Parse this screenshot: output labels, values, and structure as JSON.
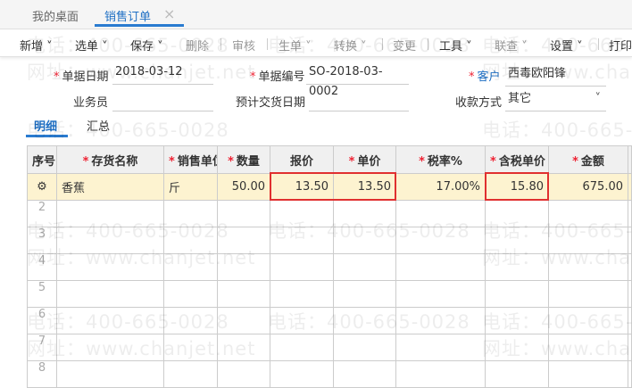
{
  "tabs": [
    {
      "label": "我的桌面"
    },
    {
      "label": "销售订单",
      "close": "×"
    }
  ],
  "toolbar": [
    "新增",
    "选单",
    "保存",
    "删除",
    "审核",
    "生单",
    "转换",
    "变更",
    "工具",
    "联查",
    "设置",
    "打印"
  ],
  "form": {
    "date_label": "单据日期",
    "date": "2018-03-12",
    "no_label": "单据编号",
    "no": "SO-2018-03-0002",
    "customer_label": "客户",
    "customer": "西毒欧阳锋",
    "salesman_label": "业务员",
    "salesman": "",
    "delivery_label": "预计交货日期",
    "delivery": "",
    "payment_label": "收款方式",
    "payment": "其它"
  },
  "subtabs": [
    "明细",
    "汇总"
  ],
  "table": {
    "headers": [
      "序号",
      "存货名称",
      "销售单位",
      "数量",
      "报价",
      "单价",
      "税率%",
      "含税单价",
      "金额"
    ],
    "rows": [
      {
        "name": "香蕉",
        "unit": "斤",
        "qty": "50.00",
        "quote": "13.50",
        "price": "13.50",
        "tax": "17.00%",
        "taxprice": "15.80",
        "amount": "675.00"
      }
    ],
    "row_numbers": [
      "2",
      "3",
      "4",
      "5",
      "6",
      "7",
      "8"
    ]
  },
  "watermark": {
    "phone": "电话：400-665-0028",
    "site": "网址：www.chanjet.net"
  },
  "colors": {
    "accent": "#1e6fc4",
    "highlight": "#e03030",
    "selected_row": "#fdf3d0"
  }
}
